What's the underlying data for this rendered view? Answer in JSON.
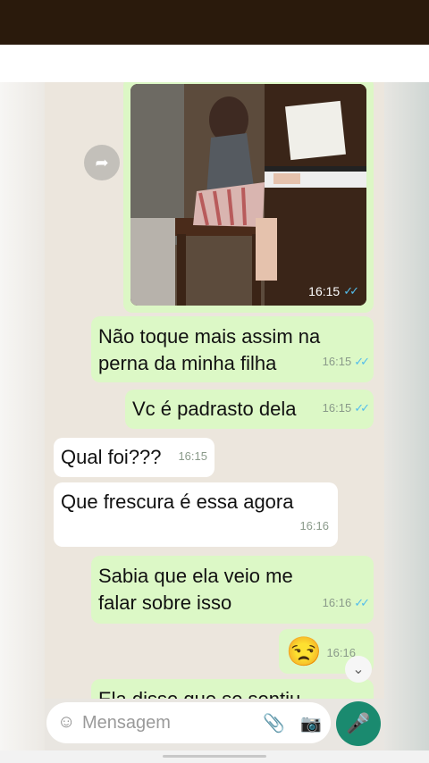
{
  "messages": [
    {
      "id": "m1",
      "type": "image",
      "time": "16:15",
      "direction": "out",
      "status": "read"
    },
    {
      "id": "m2",
      "text_line1": "Não toque mais assim na",
      "text_line2": "perna da minha filha",
      "time": "16:15",
      "direction": "out",
      "status": "read"
    },
    {
      "id": "m3",
      "text": "Vc é padrasto dela",
      "time": "16:15",
      "direction": "out",
      "status": "read"
    },
    {
      "id": "m4",
      "text": "Qual foi???",
      "time": "16:15",
      "direction": "in"
    },
    {
      "id": "m5",
      "text": "Que frescura é essa agora",
      "time": "16:16",
      "direction": "in"
    },
    {
      "id": "m6",
      "text_line1": "Sabia que ela veio me",
      "text_line2": "falar sobre isso",
      "time": "16:16",
      "direction": "out",
      "status": "read"
    },
    {
      "id": "m7",
      "emoji": "😒",
      "time": "16:16",
      "direction": "out"
    },
    {
      "id": "m8",
      "text_partial": "Ela disse que se sentiu",
      "direction": "out"
    }
  ],
  "input": {
    "placeholder": "Mensagem"
  },
  "icons": {
    "forward": "forward-icon",
    "emoji": "emoji-icon",
    "attach": "paperclip-icon",
    "camera": "camera-icon",
    "mic": "microphone-icon",
    "scroll": "chevron-down-icon",
    "ticks": "double-check-icon"
  },
  "colors": {
    "out_bubble": "#dcf8c6",
    "in_bubble": "#ffffff",
    "mic_button": "#1a8a6f",
    "read_ticks": "#53bdeb",
    "topbar": "#2a1a0c"
  }
}
